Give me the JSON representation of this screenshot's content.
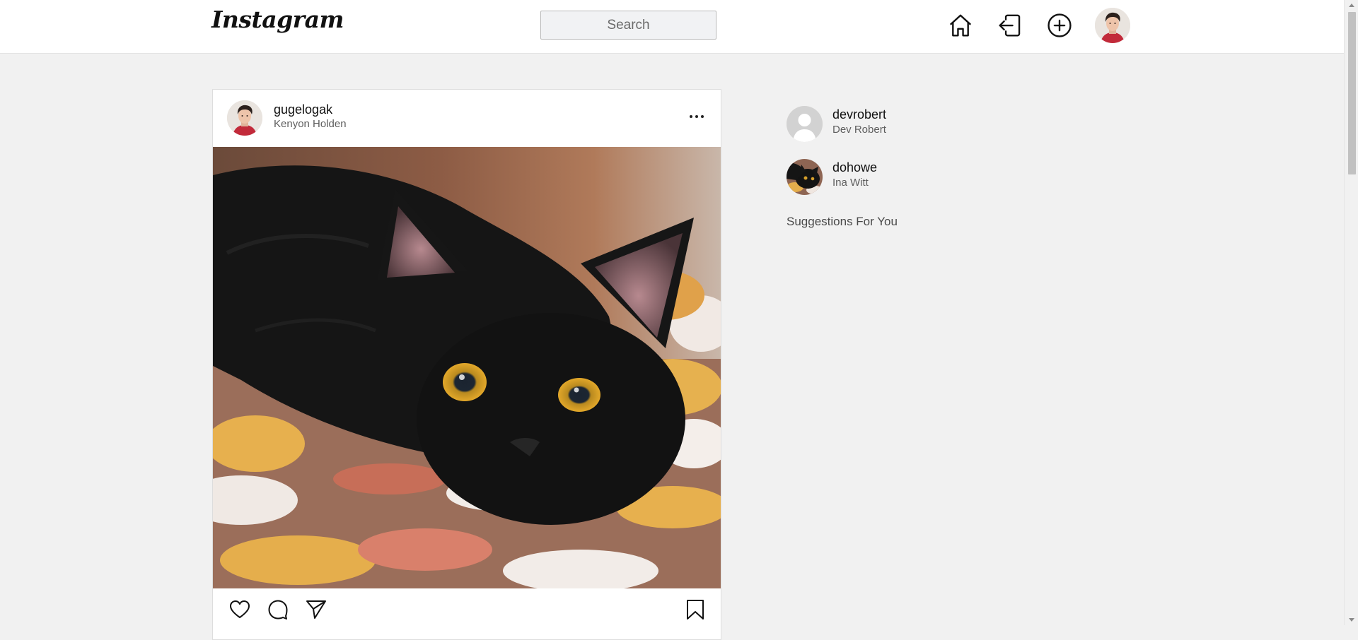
{
  "header": {
    "logo_text": "Instagram",
    "search_placeholder": "Search",
    "icons": [
      "home-icon",
      "logout-icon",
      "create-post-icon"
    ]
  },
  "post": {
    "username": "gugelogak",
    "full_name": "Kenyon Holden",
    "image_subject": "black cat lying on a patterned rug",
    "actions": [
      "like-icon",
      "comment-icon",
      "share-icon",
      "save-icon"
    ]
  },
  "sidebar": {
    "users": [
      {
        "username": "devrobert",
        "full_name": "Dev Robert"
      },
      {
        "username": "dohowe",
        "full_name": "Ina Witt"
      }
    ],
    "suggestions_heading": "Suggestions For You"
  }
}
